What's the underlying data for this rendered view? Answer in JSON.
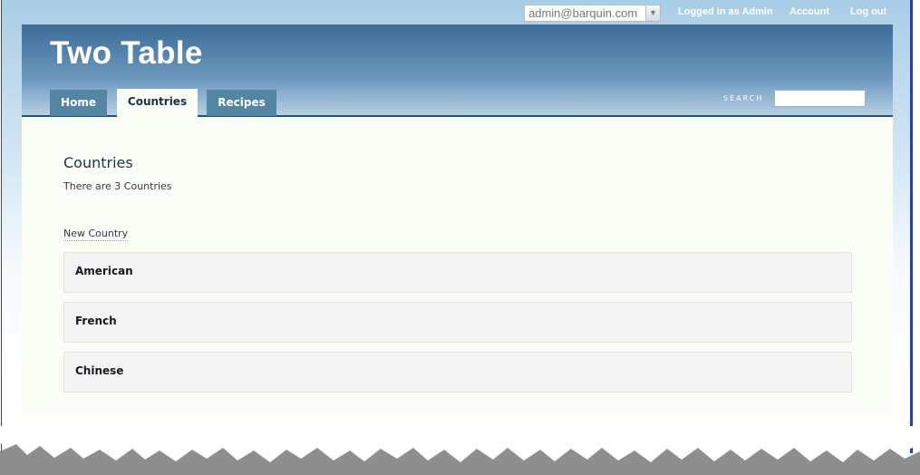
{
  "topbar": {
    "user_select_value": "admin@barquin.com",
    "logged_in_text": "Logged in as Admin",
    "account_label": "Account",
    "logout_label": "Log out"
  },
  "header": {
    "site_title": "Two Table",
    "tabs": [
      {
        "label": "Home",
        "active": false
      },
      {
        "label": "Countries",
        "active": true
      },
      {
        "label": "Recipes",
        "active": false
      }
    ],
    "search_label": "SEARCH",
    "search_value": ""
  },
  "main": {
    "title": "Countries",
    "count_text": "There are 3 Countries",
    "new_link": "New Country",
    "items": [
      {
        "label": "American"
      },
      {
        "label": "French"
      },
      {
        "label": "Chinese"
      }
    ]
  },
  "colors": {
    "header_top": "#3c6c97",
    "tab_bg": "#5286a3",
    "content_bg": "#fbfdf7",
    "row_bg": "#f4f4f4"
  }
}
